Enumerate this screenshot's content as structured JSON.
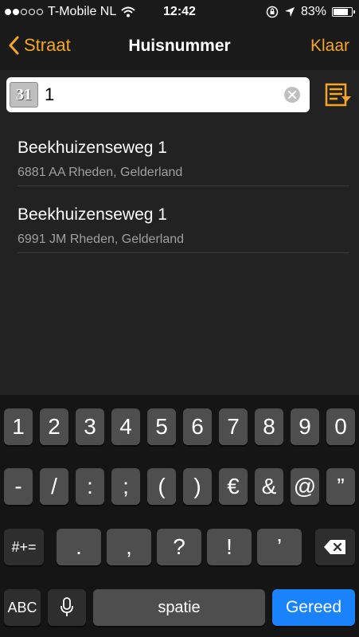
{
  "status": {
    "carrier": "T-Mobile NL",
    "time": "12:42",
    "battery": "83%",
    "battery_level": 0.83
  },
  "nav": {
    "back_label": "Straat",
    "title": "Huisnummer",
    "done_label": "Klaar"
  },
  "search": {
    "calendar_number": "31",
    "value": "1"
  },
  "results": [
    {
      "title": "Beekhuizenseweg 1",
      "subtitle": "6881 AA Rheden, Gelderland"
    },
    {
      "title": "Beekhuizenseweg 1",
      "subtitle": "6991 JM Rheden, Gelderland"
    }
  ],
  "keyboard": {
    "row1": [
      "1",
      "2",
      "3",
      "4",
      "5",
      "6",
      "7",
      "8",
      "9",
      "0"
    ],
    "row2": [
      "-",
      "/",
      ":",
      ";",
      "(",
      ")",
      "€",
      "&",
      "@",
      "”"
    ],
    "row3": [
      ".",
      ",",
      "?",
      "!",
      "’"
    ],
    "symbols_label": "#+=",
    "abc_label": "ABC",
    "space_label": "spatie",
    "return_label": "Gereed"
  },
  "colors": {
    "accent": "#f5a623",
    "return_key": "#1a82fb"
  }
}
